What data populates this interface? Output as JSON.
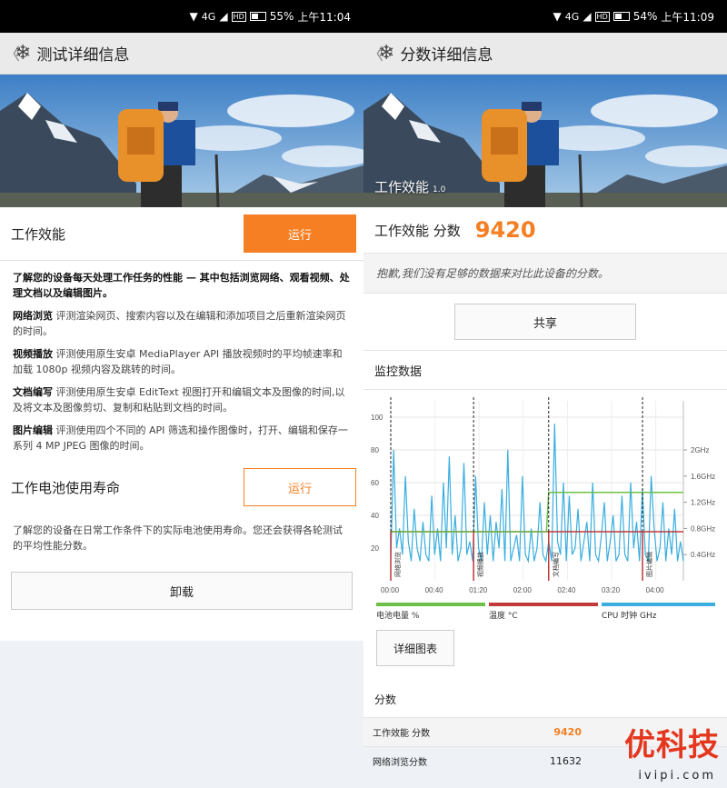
{
  "left": {
    "status": {
      "signal": "4G",
      "hd": "HD",
      "battery": "55%",
      "time": "上午11:04",
      "battery_level": 0.55
    },
    "appbar": {
      "back": "〈",
      "title": "测试详细信息"
    },
    "work": {
      "title": "工作效能",
      "run_label": "运行"
    },
    "intro": "了解您的设备每天处理工作任务的性能 — 其中包括浏览网络、观看视频、处理文档以及编辑图片。",
    "items": [
      {
        "name": "网络浏览",
        "text": "评测渲染网页、搜索内容以及在编辑和添加项目之后重新渲染网页的时间。"
      },
      {
        "name": "视频播放",
        "text": "评测使用原生安卓 MediaPlayer API 播放视频时的平均帧速率和加载 1080p 视频内容及跳转的时间。"
      },
      {
        "name": "文档编写",
        "text": "评测使用原生安卓 EditText 视图打开和编辑文本及图像的时间,以及将文本及图像剪切、复制和粘贴到文档的时间。"
      },
      {
        "name": "图片编辑",
        "text": "评测使用四个不同的 API 筛选和操作图像时，打开、编辑和保存一系列 4 MP JPEG 图像的时间。"
      }
    ],
    "battery": {
      "title": "工作电池使用寿命",
      "run_label": "运行",
      "desc": "了解您的设备在日常工作条件下的实际电池使用寿命。您还会获得各轮测试的平均性能分数。"
    },
    "uninstall_label": "卸载"
  },
  "right": {
    "status": {
      "signal": "4G",
      "hd": "HD",
      "battery": "54%",
      "time": "上午11:09",
      "battery_level": 0.54
    },
    "appbar": {
      "back": "〈",
      "title": "分数详细信息"
    },
    "hero_caption": "工作效能",
    "hero_version": "1.0",
    "score": {
      "label": "工作效能 分数",
      "value": "9420"
    },
    "apology": "抱歉,我们没有足够的数据来对比此设备的分数。",
    "share_label": "共享",
    "monitor_title": "监控数据",
    "legend": [
      {
        "label": "电池电量 %",
        "color": "#6cc04a"
      },
      {
        "label": "温度 °C",
        "color": "#c0393b"
      },
      {
        "label": "CPU 时钟 GHz",
        "color": "#3aaee0"
      }
    ],
    "detail_label": "详细图表",
    "scores_head": "分数",
    "score_rows": [
      {
        "label": "工作效能 分数",
        "value": "9420"
      },
      {
        "label": "网络浏览分数",
        "value": "11632"
      }
    ]
  },
  "watermark": {
    "brand": "优科技",
    "url": "ivipi.com"
  },
  "chart_data": {
    "type": "line",
    "x_ticks": [
      "00:00",
      "00:40",
      "01:20",
      "02:00",
      "02:40",
      "03:20",
      "04:00"
    ],
    "y_left_ticks": [
      "20",
      "40",
      "60",
      "80",
      "100"
    ],
    "y_right_ticks": [
      "0.4GHz",
      "0.8GHz",
      "1.2GHz",
      "1.6GHz",
      "2GHz"
    ],
    "ylim": [
      0,
      110
    ],
    "markers": [
      {
        "label": "网络浏览",
        "x": 0
      },
      {
        "label": "视频播放",
        "x": 75
      },
      {
        "label": "文档编写",
        "x": 143
      },
      {
        "label": "图片编辑",
        "x": 228
      }
    ],
    "battery_percent": {
      "start": 30,
      "end": 54,
      "rise_at": 143
    },
    "temperature_c": 30,
    "cpu_ghz": [
      0.3,
      2.0,
      0.5,
      0.8,
      0.4,
      1.6,
      0.6,
      0.3,
      1.1,
      0.5,
      0.3,
      0.9,
      0.4,
      0.3,
      1.3,
      0.4,
      0.8,
      0.3,
      1.5,
      0.5,
      1.9,
      0.4,
      1.0,
      0.3,
      0.5,
      1.8,
      0.4,
      0.6,
      0.3,
      1.6,
      0.5,
      0.3,
      1.2,
      0.4,
      1.0,
      0.3,
      0.9,
      0.5,
      1.4,
      0.3,
      2.0,
      0.3,
      0.5,
      0.7,
      0.3,
      1.6,
      0.4,
      0.3,
      0.8,
      0.3,
      0.5,
      1.2,
      0.4,
      0.3,
      0.6,
      0.3,
      2.4,
      0.6,
      0.4,
      1.5,
      0.3,
      1.3,
      0.4,
      0.5,
      1.1,
      0.3,
      0.6,
      0.9,
      0.3,
      1.5,
      0.4,
      0.3,
      0.7,
      1.2,
      0.3,
      0.6,
      1.0,
      0.3,
      0.4,
      1.3,
      0.4,
      0.3,
      1.5,
      0.5,
      0.9,
      0.3,
      1.4,
      0.4,
      0.3,
      1.6,
      0.8,
      0.3,
      0.5,
      1.2,
      0.3,
      0.8,
      0.4,
      1.1,
      0.3,
      0.6,
      0.3
    ]
  }
}
